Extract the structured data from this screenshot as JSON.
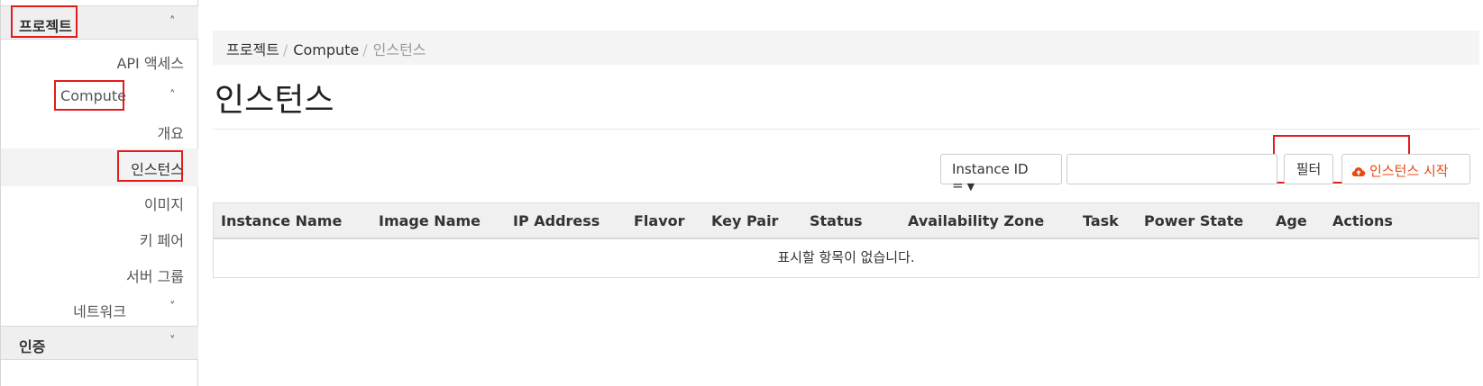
{
  "sidebar": {
    "project_label": "프로젝트",
    "api_access": "API 액세스",
    "compute_label": "Compute",
    "overview": "개요",
    "instances": "인스턴스",
    "images": "이미지",
    "key_pairs": "키 페어",
    "server_groups": "서버 그룹",
    "network": "네트워크",
    "identity": "인증"
  },
  "breadcrumb": {
    "items": [
      "프로젝트",
      "Compute"
    ],
    "current": "인스턴스",
    "separator": "/"
  },
  "page": {
    "title": "인스턴스"
  },
  "filter": {
    "select_value": "Instance ID =",
    "input_value": "",
    "filter_button": "필터"
  },
  "actions": {
    "launch_button": "인스턴스 시작",
    "accent": "#e8490f"
  },
  "table": {
    "columns": [
      "Instance Name",
      "Image Name",
      "IP Address",
      "Flavor",
      "Key Pair",
      "Status",
      "Availability Zone",
      "Task",
      "Power State",
      "Age",
      "Actions"
    ],
    "empty_message": "표시할 항목이 없습니다."
  },
  "highlight_color": "#e01d1d"
}
